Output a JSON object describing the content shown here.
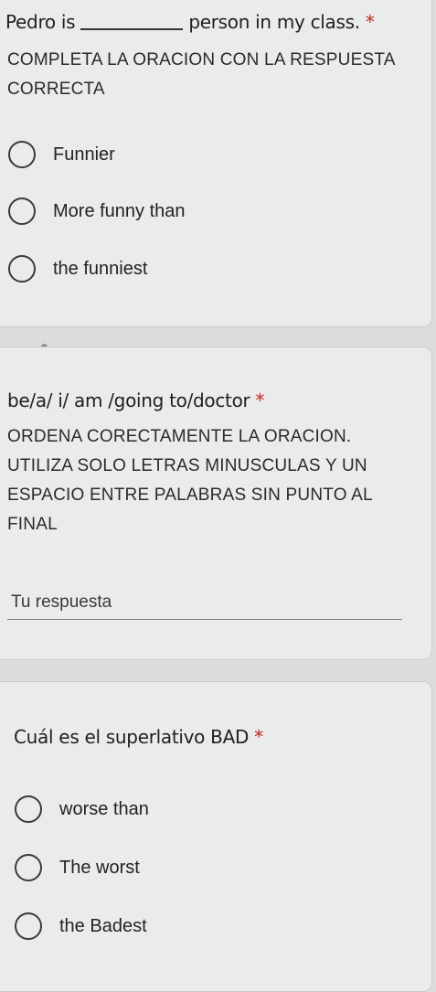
{
  "q1": {
    "title_before": "Pedro is",
    "title_after": "person in my class.",
    "required_mark": "*",
    "description": "COMPLETA LA ORACION CON LA RESPUESTA CORRECTA",
    "options": [
      "Funnier",
      "More funny than",
      "the funniest"
    ]
  },
  "q2": {
    "title": "be/a/ i/ am /going to/doctor",
    "required_mark": "*",
    "description": "ORDENA CORECTAMENTE LA ORACION. UTILIZA SOLO LETRAS MINUSCULAS Y UN ESPACIO ENTRE PALABRAS SIN PUNTO AL FINAL",
    "answer_placeholder": "Tu respuesta"
  },
  "q3": {
    "title": "Cuál es el superlativo BAD",
    "required_mark": "*",
    "options": [
      "worse than",
      "The worst",
      "the Badest"
    ]
  }
}
